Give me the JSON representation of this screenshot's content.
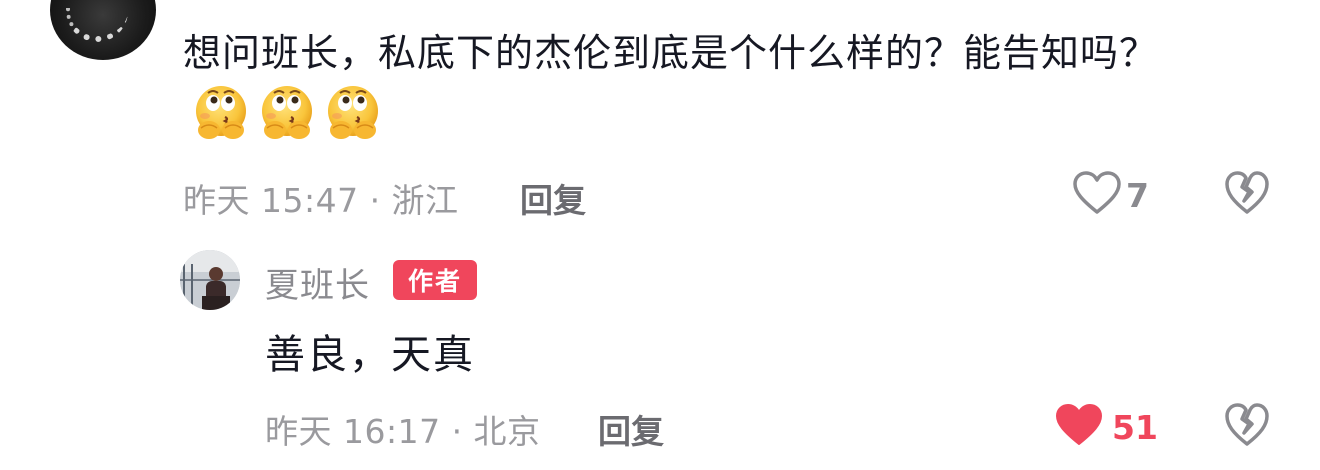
{
  "comment": {
    "text": "想问班长，私底下的杰伦到底是个什么样的？能告知吗？",
    "emoji_name": "thinking-kiss-emoji",
    "emoji_count": 3,
    "meta": "昨天 15:47 · 浙江",
    "reply_label": "回复",
    "like_count": "7",
    "liked": false
  },
  "reply": {
    "author": "夏班长",
    "badge": "作者",
    "text": "善良，天真",
    "meta": "昨天 16:17 · 北京",
    "reply_label": "回复",
    "like_count": "51",
    "liked": true
  },
  "colors": {
    "liked_red": "#f0465c",
    "meta_gray": "#9a9a9e",
    "text_dark": "#161823"
  }
}
